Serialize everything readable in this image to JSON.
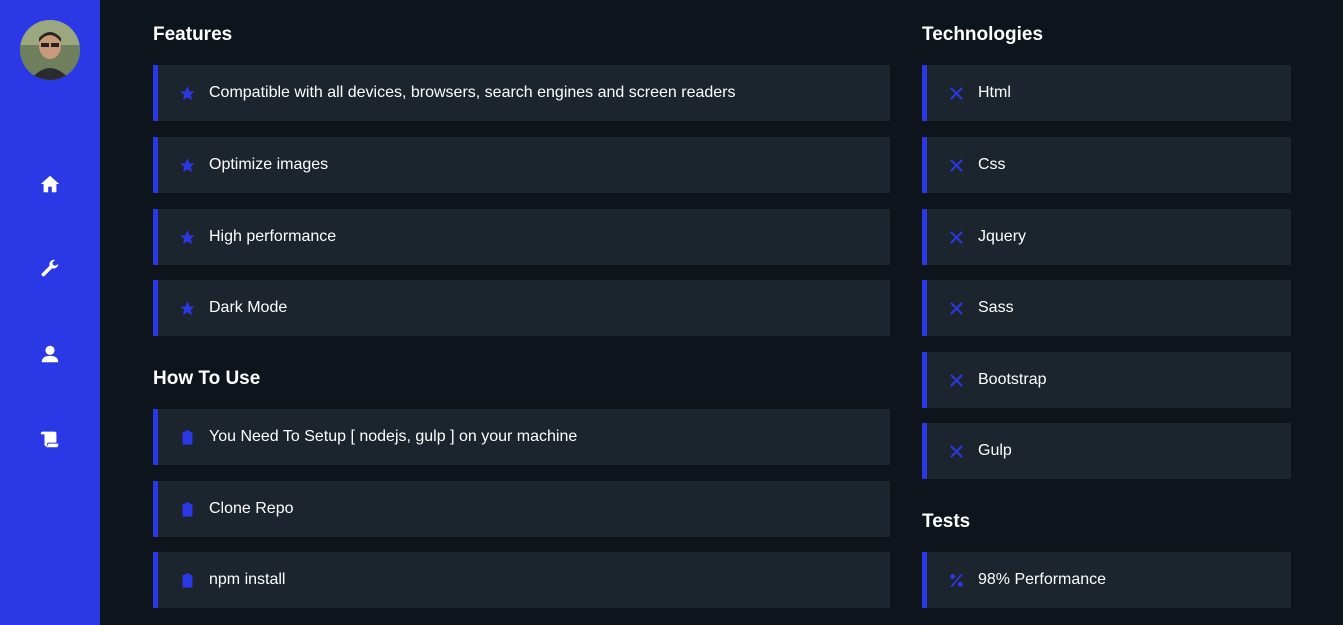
{
  "sidebar": {
    "avatar_alt": "profile photo",
    "nav": [
      {
        "icon": "home-icon"
      },
      {
        "icon": "wrench-icon"
      },
      {
        "icon": "user-icon"
      },
      {
        "icon": "scroll-icon"
      }
    ]
  },
  "features": {
    "title": "Features",
    "items": [
      {
        "label": "Compatible with all devices, browsers, search engines and screen readers",
        "icon": "star-icon"
      },
      {
        "label": "Optimize images",
        "icon": "star-icon"
      },
      {
        "label": "High performance",
        "icon": "star-icon"
      },
      {
        "label": "Dark Mode",
        "icon": "star-icon"
      }
    ]
  },
  "how_to_use": {
    "title": "How To Use",
    "items": [
      {
        "label": "You Need To Setup [ nodejs, gulp ] on your machine",
        "icon": "clipboard-icon"
      },
      {
        "label": "Clone Repo",
        "icon": "clipboard-icon"
      },
      {
        "label": "npm install",
        "icon": "clipboard-icon"
      }
    ]
  },
  "technologies": {
    "title": "Technologies",
    "items": [
      {
        "label": "Html",
        "icon": "tools-icon"
      },
      {
        "label": "Css",
        "icon": "tools-icon"
      },
      {
        "label": "Jquery",
        "icon": "tools-icon"
      },
      {
        "label": "Sass",
        "icon": "tools-icon"
      },
      {
        "label": "Bootstrap",
        "icon": "tools-icon"
      },
      {
        "label": "Gulp",
        "icon": "tools-icon"
      }
    ]
  },
  "tests": {
    "title": "Tests",
    "items": [
      {
        "label": "98% Performance",
        "icon": "percent-icon"
      }
    ]
  },
  "colors": {
    "accent": "#2a38e6",
    "background": "#0e141b",
    "card": "#1c242e"
  }
}
